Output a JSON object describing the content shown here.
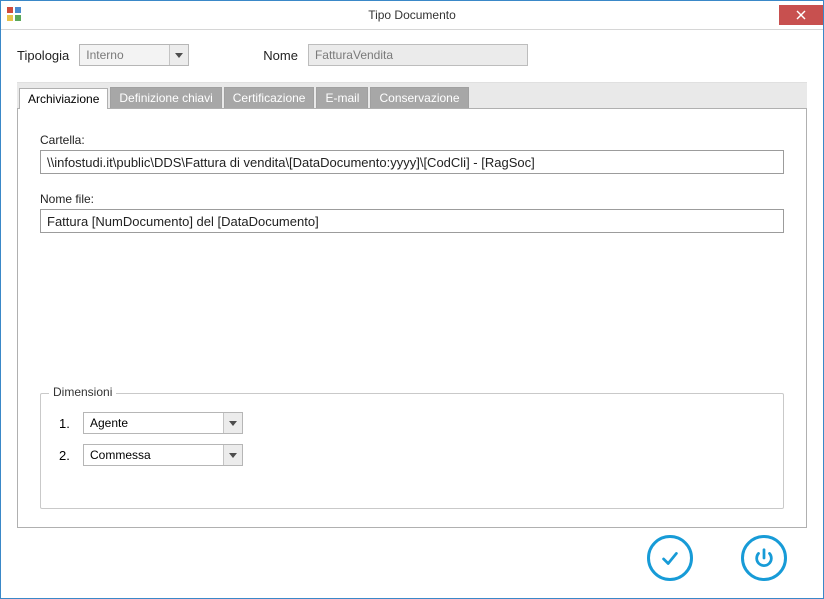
{
  "window": {
    "title": "Tipo Documento"
  },
  "header": {
    "tipologia_label": "Tipologia",
    "tipologia_value": "Interno",
    "nome_label": "Nome",
    "nome_value": "FatturaVendita"
  },
  "tabs": [
    {
      "label": "Archiviazione",
      "active": true
    },
    {
      "label": "Definizione chiavi",
      "active": false
    },
    {
      "label": "Certificazione",
      "active": false
    },
    {
      "label": "E-mail",
      "active": false
    },
    {
      "label": "Conservazione",
      "active": false
    }
  ],
  "archiviazione": {
    "cartella_label": "Cartella:",
    "cartella_value": "\\\\infostudi.it\\public\\DDS\\Fattura di vendita\\[DataDocumento:yyyy]\\[CodCli] - [RagSoc]",
    "nomefile_label": "Nome file:",
    "nomefile_value": "Fattura [NumDocumento] del [DataDocumento]",
    "dimensioni_label": "Dimensioni",
    "dimensioni": [
      {
        "index": "1.",
        "value": "Agente"
      },
      {
        "index": "2.",
        "value": "Commessa"
      }
    ]
  },
  "colors": {
    "accent": "#179bd7",
    "close": "#c8504f"
  }
}
